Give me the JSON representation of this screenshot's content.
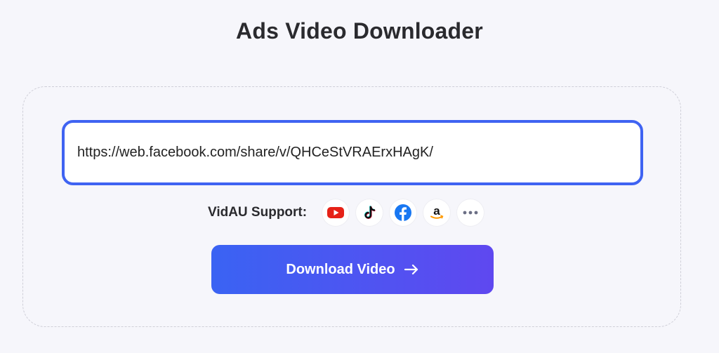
{
  "page": {
    "title": "Ads Video Downloader"
  },
  "url_input": {
    "value": "https://web.facebook.com/share/v/QHCeStVRAErxHAgK/"
  },
  "support": {
    "label": "VidAU Support:",
    "platforms": [
      "youtube-icon",
      "tiktok-icon",
      "facebook-icon",
      "amazon-icon",
      "more-icon"
    ]
  },
  "download": {
    "label": "Download Video"
  },
  "colors": {
    "accent": "#3f63f2",
    "button_gradient_start": "#3a63f3",
    "button_gradient_end": "#5f48f0",
    "background": "#f6f6fb"
  }
}
